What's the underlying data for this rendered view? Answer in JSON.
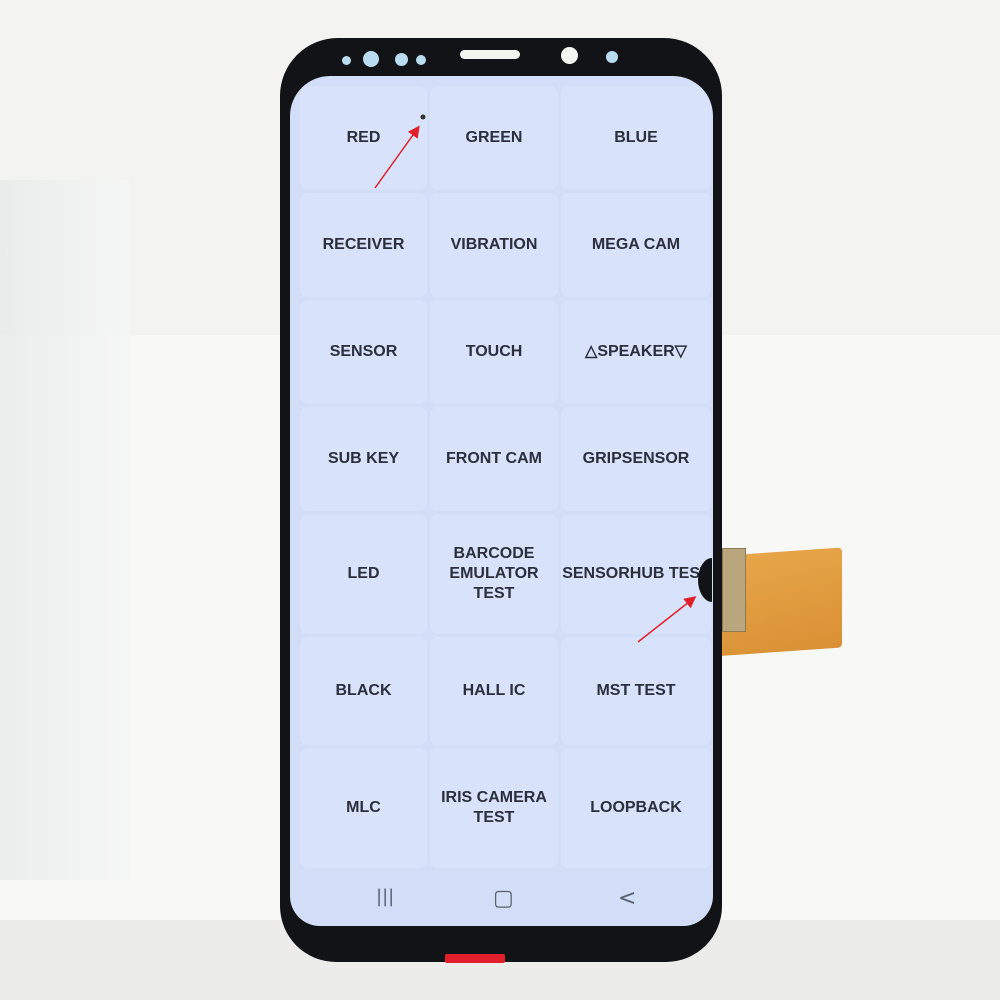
{
  "tests": [
    "RED",
    "GREEN",
    "BLUE",
    "RECEIVER",
    "VIBRATION",
    "MEGA CAM",
    "SENSOR",
    "TOUCH",
    "△SPEAKER▽",
    "SUB KEY",
    "FRONT CAM",
    "GRIPSENSOR",
    "LED",
    "BARCODE\nEMULATOR TEST",
    "SENSORHUB TEST",
    "BLACK",
    "HALL IC",
    "MST TEST",
    "MLC",
    "IRIS CAMERA\nTEST",
    "LOOPBACK"
  ],
  "nav": {
    "recents": "|||",
    "home": "▢",
    "back": "<"
  },
  "colors": {
    "screen": "#d2def8",
    "bezel": "#121316",
    "arrow": "#e01f2a"
  }
}
